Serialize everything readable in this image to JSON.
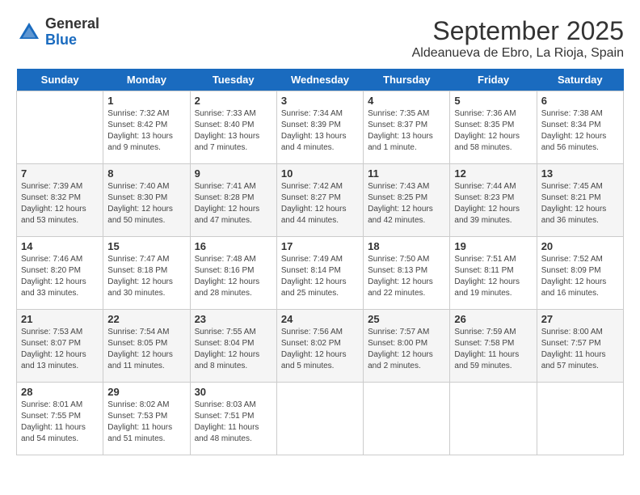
{
  "logo": {
    "general": "General",
    "blue": "Blue"
  },
  "title": "September 2025",
  "subtitle": "Aldeanueva de Ebro, La Rioja, Spain",
  "headers": [
    "Sunday",
    "Monday",
    "Tuesday",
    "Wednesday",
    "Thursday",
    "Friday",
    "Saturday"
  ],
  "weeks": [
    [
      {
        "day": "",
        "info": ""
      },
      {
        "day": "1",
        "info": "Sunrise: 7:32 AM\nSunset: 8:42 PM\nDaylight: 13 hours\nand 9 minutes."
      },
      {
        "day": "2",
        "info": "Sunrise: 7:33 AM\nSunset: 8:40 PM\nDaylight: 13 hours\nand 7 minutes."
      },
      {
        "day": "3",
        "info": "Sunrise: 7:34 AM\nSunset: 8:39 PM\nDaylight: 13 hours\nand 4 minutes."
      },
      {
        "day": "4",
        "info": "Sunrise: 7:35 AM\nSunset: 8:37 PM\nDaylight: 13 hours\nand 1 minute."
      },
      {
        "day": "5",
        "info": "Sunrise: 7:36 AM\nSunset: 8:35 PM\nDaylight: 12 hours\nand 58 minutes."
      },
      {
        "day": "6",
        "info": "Sunrise: 7:38 AM\nSunset: 8:34 PM\nDaylight: 12 hours\nand 56 minutes."
      }
    ],
    [
      {
        "day": "7",
        "info": "Sunrise: 7:39 AM\nSunset: 8:32 PM\nDaylight: 12 hours\nand 53 minutes."
      },
      {
        "day": "8",
        "info": "Sunrise: 7:40 AM\nSunset: 8:30 PM\nDaylight: 12 hours\nand 50 minutes."
      },
      {
        "day": "9",
        "info": "Sunrise: 7:41 AM\nSunset: 8:28 PM\nDaylight: 12 hours\nand 47 minutes."
      },
      {
        "day": "10",
        "info": "Sunrise: 7:42 AM\nSunset: 8:27 PM\nDaylight: 12 hours\nand 44 minutes."
      },
      {
        "day": "11",
        "info": "Sunrise: 7:43 AM\nSunset: 8:25 PM\nDaylight: 12 hours\nand 42 minutes."
      },
      {
        "day": "12",
        "info": "Sunrise: 7:44 AM\nSunset: 8:23 PM\nDaylight: 12 hours\nand 39 minutes."
      },
      {
        "day": "13",
        "info": "Sunrise: 7:45 AM\nSunset: 8:21 PM\nDaylight: 12 hours\nand 36 minutes."
      }
    ],
    [
      {
        "day": "14",
        "info": "Sunrise: 7:46 AM\nSunset: 8:20 PM\nDaylight: 12 hours\nand 33 minutes."
      },
      {
        "day": "15",
        "info": "Sunrise: 7:47 AM\nSunset: 8:18 PM\nDaylight: 12 hours\nand 30 minutes."
      },
      {
        "day": "16",
        "info": "Sunrise: 7:48 AM\nSunset: 8:16 PM\nDaylight: 12 hours\nand 28 minutes."
      },
      {
        "day": "17",
        "info": "Sunrise: 7:49 AM\nSunset: 8:14 PM\nDaylight: 12 hours\nand 25 minutes."
      },
      {
        "day": "18",
        "info": "Sunrise: 7:50 AM\nSunset: 8:13 PM\nDaylight: 12 hours\nand 22 minutes."
      },
      {
        "day": "19",
        "info": "Sunrise: 7:51 AM\nSunset: 8:11 PM\nDaylight: 12 hours\nand 19 minutes."
      },
      {
        "day": "20",
        "info": "Sunrise: 7:52 AM\nSunset: 8:09 PM\nDaylight: 12 hours\nand 16 minutes."
      }
    ],
    [
      {
        "day": "21",
        "info": "Sunrise: 7:53 AM\nSunset: 8:07 PM\nDaylight: 12 hours\nand 13 minutes."
      },
      {
        "day": "22",
        "info": "Sunrise: 7:54 AM\nSunset: 8:05 PM\nDaylight: 12 hours\nand 11 minutes."
      },
      {
        "day": "23",
        "info": "Sunrise: 7:55 AM\nSunset: 8:04 PM\nDaylight: 12 hours\nand 8 minutes."
      },
      {
        "day": "24",
        "info": "Sunrise: 7:56 AM\nSunset: 8:02 PM\nDaylight: 12 hours\nand 5 minutes."
      },
      {
        "day": "25",
        "info": "Sunrise: 7:57 AM\nSunset: 8:00 PM\nDaylight: 12 hours\nand 2 minutes."
      },
      {
        "day": "26",
        "info": "Sunrise: 7:59 AM\nSunset: 7:58 PM\nDaylight: 11 hours\nand 59 minutes."
      },
      {
        "day": "27",
        "info": "Sunrise: 8:00 AM\nSunset: 7:57 PM\nDaylight: 11 hours\nand 57 minutes."
      }
    ],
    [
      {
        "day": "28",
        "info": "Sunrise: 8:01 AM\nSunset: 7:55 PM\nDaylight: 11 hours\nand 54 minutes."
      },
      {
        "day": "29",
        "info": "Sunrise: 8:02 AM\nSunset: 7:53 PM\nDaylight: 11 hours\nand 51 minutes."
      },
      {
        "day": "30",
        "info": "Sunrise: 8:03 AM\nSunset: 7:51 PM\nDaylight: 11 hours\nand 48 minutes."
      },
      {
        "day": "",
        "info": ""
      },
      {
        "day": "",
        "info": ""
      },
      {
        "day": "",
        "info": ""
      },
      {
        "day": "",
        "info": ""
      }
    ]
  ]
}
